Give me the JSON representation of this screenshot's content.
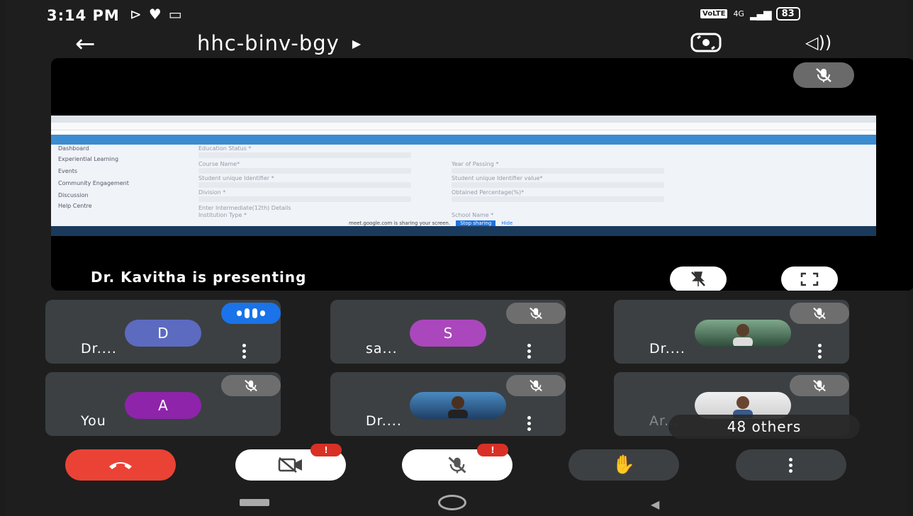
{
  "status_bar": {
    "time": "3:14 PM",
    "left_icons": [
      "cast-icon",
      "heart-icon",
      "video-icon"
    ],
    "network": "4G",
    "volte": "VoLTE",
    "battery": "83"
  },
  "top_bar": {
    "meeting_code": "hhc-binv-bgy"
  },
  "presentation": {
    "label": "Dr. Kavitha is presenting",
    "shared_screen": {
      "sidebar": [
        "Dashboard",
        "Experiential Learning",
        "Events",
        "Community Engagement",
        "Discussion",
        "Help Centre"
      ],
      "fields": [
        "Education Status *",
        "Course Name*",
        "Year of Passing *",
        "Student unique Identifier *",
        "Student unique Identifier value*",
        "Division *",
        "Obtained Percentage(%)*",
        "Enter Intermediate(12th) Details",
        "Institution Type *",
        "School Name *"
      ],
      "share_notice": "meet.google.com is sharing your screen.",
      "stop_sharing": "Stop sharing",
      "hide": "Hide"
    }
  },
  "participants": [
    {
      "name": "Dr....",
      "initial": "D",
      "color": "#5c6bc0",
      "state": "speaking"
    },
    {
      "name": "sa...",
      "initial": "S",
      "color": "#ab47bc",
      "state": "muted"
    },
    {
      "name": "Dr....",
      "initial": "",
      "color": "#6a8a6a",
      "state": "muted"
    },
    {
      "name": "You",
      "initial": "A",
      "color": "#8e24aa",
      "state": "muted"
    },
    {
      "name": "Dr....",
      "initial": "",
      "color": "#3a5f8a",
      "state": "muted"
    },
    {
      "name": "Ar...",
      "initial": "",
      "color": "#8a6a4a",
      "state": "muted"
    }
  ],
  "others": "48 others",
  "controls": {
    "end_call": "end-call",
    "camera_alert": "!",
    "mic_alert": "!"
  },
  "colors": {
    "end_call": "#ea4335",
    "tile_bg": "#3c4043",
    "speaking": "#1a73e8",
    "alert": "#d93025"
  }
}
